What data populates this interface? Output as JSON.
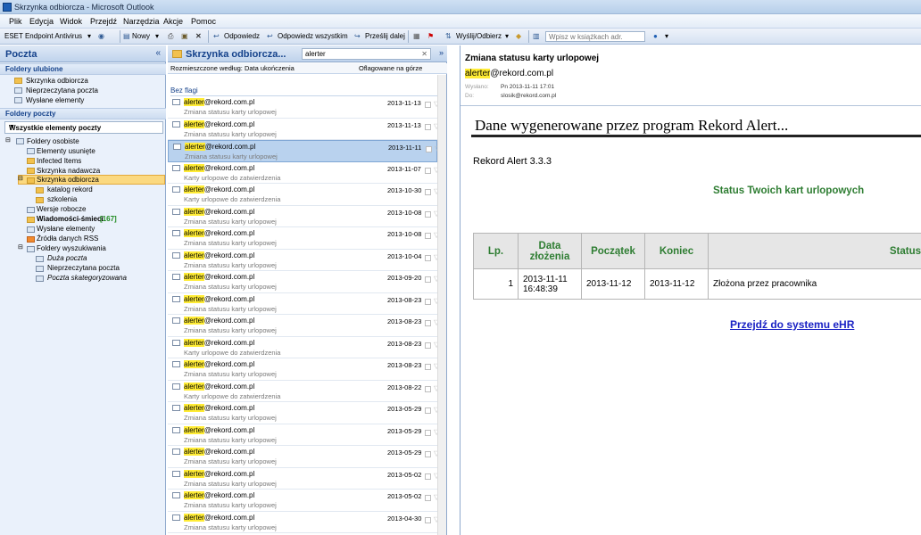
{
  "window": {
    "title": "Skrzynka odbiorcza - Microsoft Outlook"
  },
  "menu": [
    "Plik",
    "Edycja",
    "Widok",
    "Przejdź",
    "Narzędzia",
    "Akcje",
    "Pomoc"
  ],
  "toolbar": {
    "antivirus": "ESET Endpoint Antivirus",
    "new": "Nowy",
    "reply": "Odpowiedz",
    "reply_all": "Odpowiedz wszystkim",
    "forward": "Prześlij dalej",
    "send_receive": "Wyślij/Odbierz",
    "address_placeholder": "Wpisz w książkach adr."
  },
  "nav": {
    "title": "Poczta",
    "favorites_header": "Foldery ulubione",
    "favorites": [
      "Skrzynka odbiorcza",
      "Nieprzeczytana poczta",
      "Wysłane elementy"
    ],
    "mail_folders_header": "Foldery poczty",
    "all_items": "Wszystkie elementy poczty",
    "tree": {
      "root": "Foldery osobiste",
      "items": [
        "Elementy usunięte",
        "Infected Items",
        "Skrzynka nadawcza",
        "Skrzynka odbiorcza",
        "katalog rekord",
        "szkolenia",
        "Wersje robocze",
        "Wiadomości-śmieci",
        "Wysłane elementy",
        "Źródła danych RSS"
      ],
      "junk_count": "[167]",
      "search_root": "Foldery wyszukiwania",
      "search_items": [
        "Duża poczta",
        "Nieprzeczytana poczta",
        "Poczta skategoryzowana"
      ]
    }
  },
  "list": {
    "title": "Skrzynka odbiorcza...",
    "search_value": "alerter",
    "sort_by": "Rozmieszczone według: Data ukończenia",
    "sort_order": "Oflagowane na górze",
    "group": "Bez flagi",
    "sender_hl": "alerter",
    "sender_rest": "@rekord.com.pl",
    "rows": [
      {
        "date": "2013-11-13",
        "subject": "Zmiana statusu karty urlopowej"
      },
      {
        "date": "2013-11-13",
        "subject": "Zmiana statusu karty urlopowej"
      },
      {
        "date": "2013-11-11",
        "subject": "Zmiana statusu karty urlopowej"
      },
      {
        "date": "2013-11-07",
        "subject": "Karty urlopowe do zatwierdzenia"
      },
      {
        "date": "2013-10-30",
        "subject": "Karty urlopowe do zatwierdzenia"
      },
      {
        "date": "2013-10-08",
        "subject": "Zmiana statusu karty urlopowej"
      },
      {
        "date": "2013-10-08",
        "subject": "Zmiana statusu karty urlopowej"
      },
      {
        "date": "2013-10-04",
        "subject": "Zmiana statusu karty urlopowej"
      },
      {
        "date": "2013-09-20",
        "subject": "Zmiana statusu karty urlopowej"
      },
      {
        "date": "2013-08-23",
        "subject": "Zmiana statusu karty urlopowej"
      },
      {
        "date": "2013-08-23",
        "subject": "Zmiana statusu karty urlopowej"
      },
      {
        "date": "2013-08-23",
        "subject": "Karty urlopowe do zatwierdzenia"
      },
      {
        "date": "2013-08-23",
        "subject": "Zmiana statusu karty urlopowej"
      },
      {
        "date": "2013-08-22",
        "subject": "Karty urlopowe do zatwierdzenia"
      },
      {
        "date": "2013-05-29",
        "subject": "Zmiana statusu karty urlopowej"
      },
      {
        "date": "2013-05-29",
        "subject": "Zmiana statusu karty urlopowej"
      },
      {
        "date": "2013-05-29",
        "subject": "Zmiana statusu karty urlopowej"
      },
      {
        "date": "2013-05-02",
        "subject": "Zmiana statusu karty urlopowej"
      },
      {
        "date": "2013-05-02",
        "subject": "Zmiana statusu karty urlopowej"
      },
      {
        "date": "2013-04-30",
        "subject": "Zmiana statusu karty urlopowej"
      }
    ]
  },
  "reading": {
    "subject": "Zmiana statusu karty urlopowej",
    "from_hl": "alerter",
    "from_rest": "@rekord.com.pl",
    "sent_label": "Wysłano:",
    "sent_value": "Pn 2013-11-11 17:01",
    "to_label": "Do:",
    "to_value": "slosik@rekord.com.pl",
    "generated": "Dane wygenerowane przez program Rekord Alert...",
    "version": "Rekord Alert 3.3.3",
    "status_title": "Status Twoich kart urlopowych",
    "table_headers": [
      "Lp.",
      "Data złożenia",
      "Początek",
      "Koniec",
      "Status"
    ],
    "table_row": [
      "1",
      "2013-11-11 16:48:39",
      "2013-11-12",
      "2013-11-12",
      "Złożona przez pracownika"
    ],
    "link": "Przejdź do systemu eHR"
  }
}
